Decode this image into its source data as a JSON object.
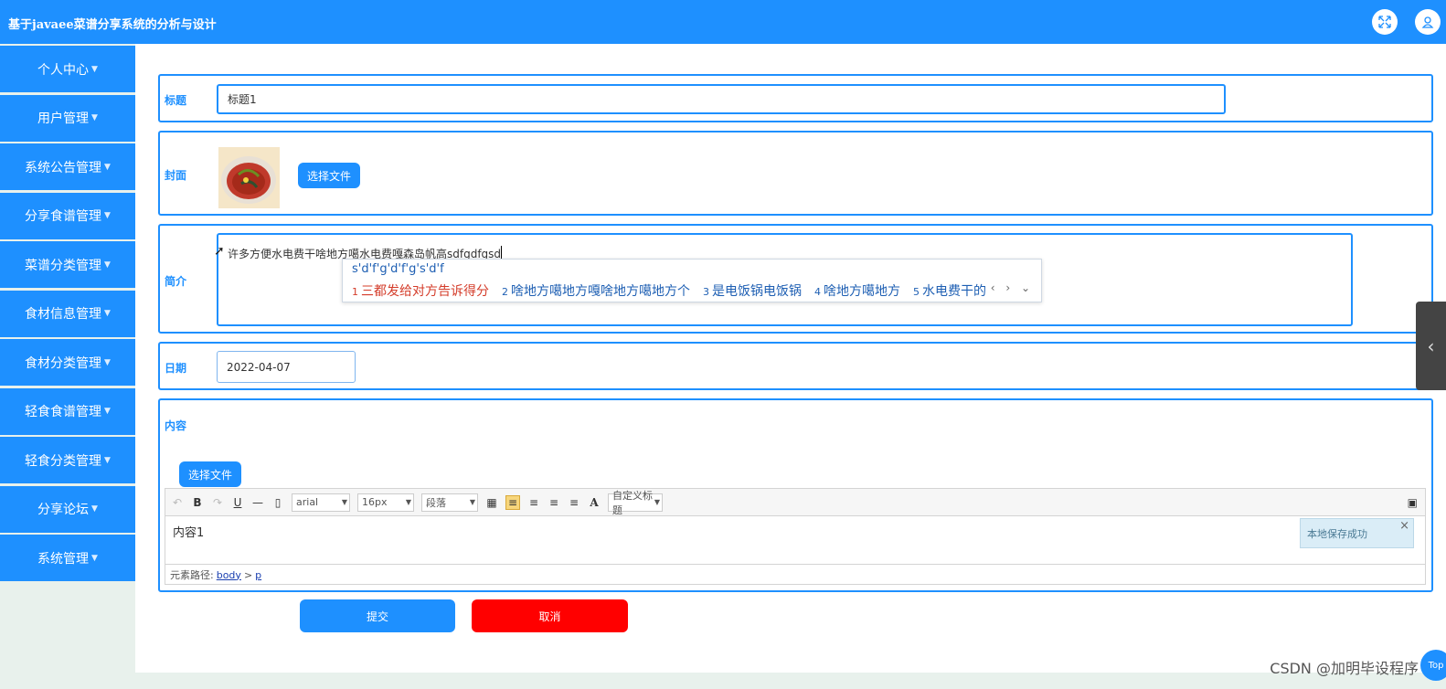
{
  "header": {
    "title": "基于javaee菜谱分享系统的分析与设计"
  },
  "sidebar": {
    "items": [
      {
        "label": "个人中心"
      },
      {
        "label": "用户管理"
      },
      {
        "label": "系统公告管理"
      },
      {
        "label": "分享食谱管理"
      },
      {
        "label": "菜谱分类管理"
      },
      {
        "label": "食材信息管理"
      },
      {
        "label": "食材分类管理"
      },
      {
        "label": "轻食食谱管理"
      },
      {
        "label": "轻食分类管理"
      },
      {
        "label": "分享论坛"
      },
      {
        "label": "系统管理"
      }
    ]
  },
  "form": {
    "title_label": "标题",
    "title_value": "标题1",
    "cover_label": "封面",
    "cover_button": "选择文件",
    "intro_label": "简介",
    "intro_value": "许多方便水电费干啥地方噶水电费嘎森岛帆高sdfgdfgsd",
    "date_label": "日期",
    "date_value": "2022-04-07",
    "content_label": "内容",
    "content_button": "选择文件",
    "submit_label": "提交",
    "cancel_label": "取消"
  },
  "ime": {
    "pinyin": "s'd'f'g'd'f'g's'd'f",
    "candidates": [
      {
        "n": "1",
        "text": "三都发给对方告诉得分"
      },
      {
        "n": "2",
        "text": "啥地方噶地方嘎啥地方噶地方个"
      },
      {
        "n": "3",
        "text": "是电饭锅电饭锅"
      },
      {
        "n": "4",
        "text": "啥地方噶地方"
      },
      {
        "n": "5",
        "text": "水电费干的"
      }
    ]
  },
  "editor": {
    "font": "arial",
    "size": "16px",
    "paragraph": "段落",
    "custom_title": "自定义标题",
    "content": "内容1",
    "path_label": "元素路径:",
    "path_body": "body",
    "path_sep": ">",
    "path_p": "p",
    "toast": "本地保存成功"
  },
  "footer": {
    "watermark": "CSDN @加明毕设程序",
    "top_label": "Top"
  },
  "colors": {
    "primary": "#1e90ff",
    "danger": "#ff0000",
    "ime_active": "#d43c2a"
  }
}
